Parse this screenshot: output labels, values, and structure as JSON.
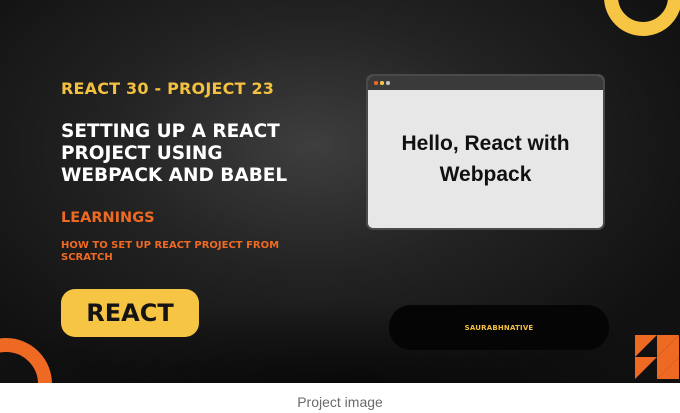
{
  "banner": {
    "kicker": "REACT 30 - PROJECT 23",
    "headline": "SETTING UP A REACT\nPROJECT USING\nWEBPACK AND BABEL",
    "learnings_heading": "LEARNINGS",
    "learnings_text": "HOW TO SET UP REACT PROJECT FROM SCRATCH",
    "badge_label": "REACT",
    "author": "SAURABHNATIVE",
    "browser_window": {
      "content": "Hello, React with\nWebpack",
      "dot_colors": [
        "#ee6a23",
        "#f7c544",
        "#bdbdbd"
      ]
    },
    "colors": {
      "accent_yellow": "#f7c544",
      "accent_orange": "#ee6a23",
      "background": "#1c1c1c"
    }
  },
  "caption": "Project image"
}
